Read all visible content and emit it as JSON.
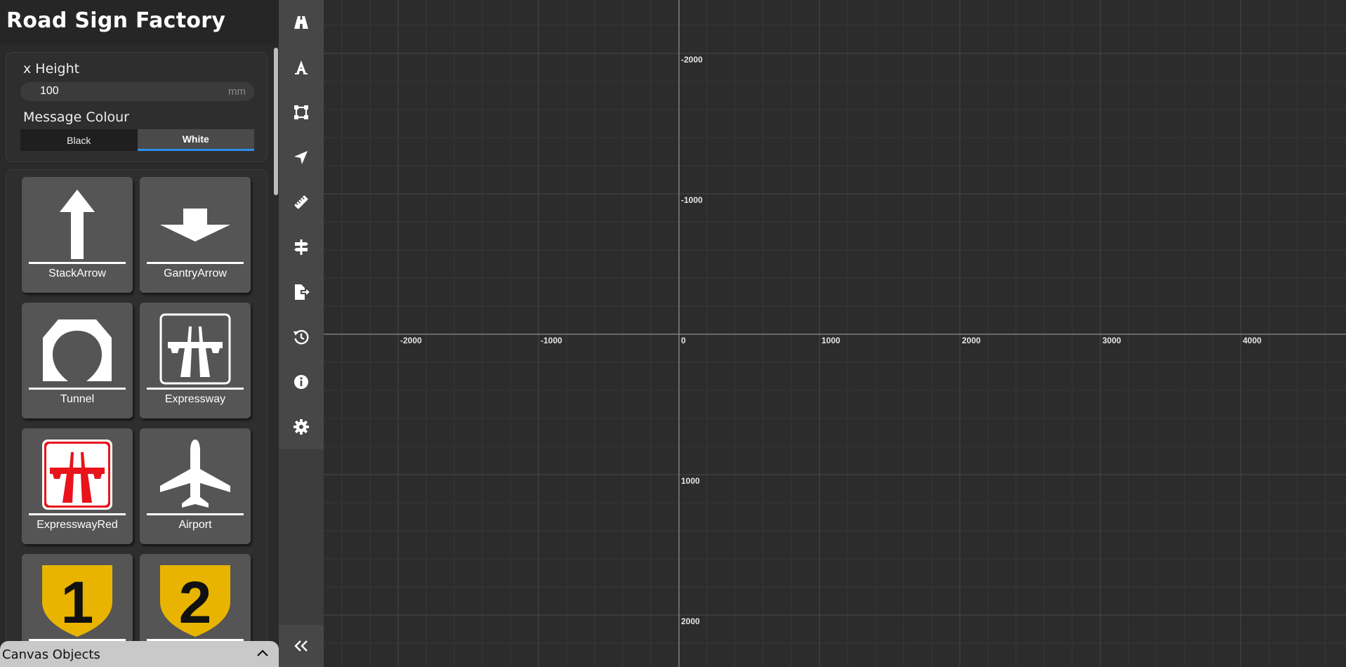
{
  "app": {
    "title": "Road Sign Factory"
  },
  "settings": {
    "x_height_label": "x Height",
    "x_height_value": "100",
    "x_height_unit": "mm",
    "message_colour_label": "Message Colour",
    "colour_options": [
      "Black",
      "White"
    ],
    "selected_colour": "White"
  },
  "library": {
    "items": [
      {
        "label": "StackArrow",
        "icon": "stack-arrow-icon"
      },
      {
        "label": "GantryArrow",
        "icon": "gantry-arrow-icon"
      },
      {
        "label": "Tunnel",
        "icon": "tunnel-icon"
      },
      {
        "label": "Expressway",
        "icon": "expressway-icon"
      },
      {
        "label": "ExpresswayRed",
        "icon": "expressway-red-icon"
      },
      {
        "label": "Airport",
        "icon": "airplane-icon"
      },
      {
        "label": "1",
        "icon": "route-shield-1-icon"
      },
      {
        "label": "2",
        "icon": "route-shield-2-icon"
      }
    ]
  },
  "canvas_objects": {
    "label": "Canvas Objects"
  },
  "toolbar": {
    "tools": [
      "road-icon",
      "text-icon",
      "shape-icon",
      "direction-arrow-icon",
      "ruler-icon",
      "signpost-icon",
      "export-icon",
      "history-icon",
      "info-icon",
      "gear-icon"
    ],
    "collapse_icon": "double-chevron-left-icon"
  },
  "canvas": {
    "x_ticks": [
      "-2000",
      "-1000",
      "0",
      "1000",
      "2000",
      "3000",
      "4000"
    ],
    "y_ticks": [
      "-2000",
      "-1000",
      "1000",
      "2000"
    ],
    "colors": {
      "background": "#2c2c2c",
      "minor_grid": "#373737",
      "major_grid": "#444444",
      "axis": "#8a8a8a"
    }
  },
  "colors": {
    "accent": "#2e8ee8",
    "shield_yellow": "#e8b400",
    "expressway_red": "#e8131b"
  }
}
